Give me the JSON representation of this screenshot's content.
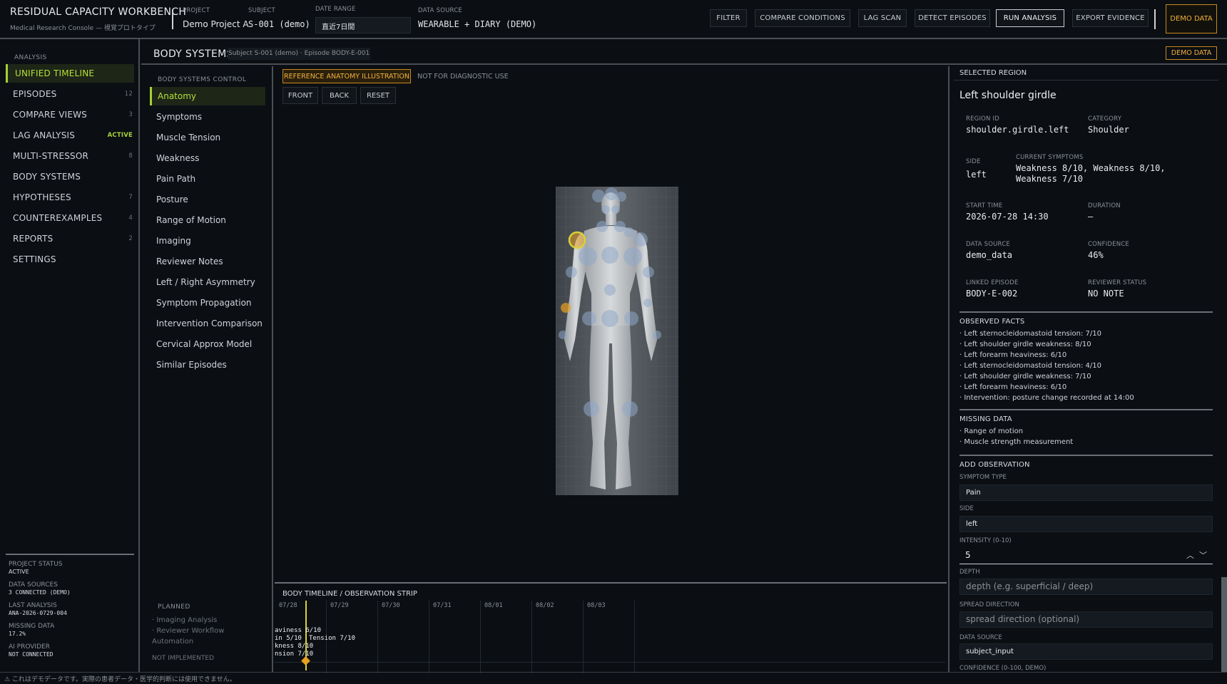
{
  "app": {
    "title": "RESIDUAL CAPACITY WORKBENCH",
    "subtitle": "Medical Research Console — 視覚プロトタイプ"
  },
  "meta": {
    "project_label": "PROJECT",
    "project": "Demo Project A",
    "subject_label": "SUBJECT",
    "subject": "S-001 (demo)",
    "daterange_label": "DATE RANGE",
    "daterange": "直近7日間",
    "source_label": "DATA SOURCE",
    "source": "WEARABLE + DIARY (DEMO)"
  },
  "toolbar": {
    "filter": "FILTER",
    "compare": "COMPARE CONDITIONS",
    "lag": "LAG SCAN",
    "detect": "DETECT EPISODES",
    "run": "RUN ANALYSIS",
    "export": "EXPORT EVIDENCE",
    "demo": "DEMO DATA"
  },
  "nav": {
    "section": "ANALYSIS",
    "items": [
      {
        "label": "UNIFIED TIMELINE",
        "badge": ""
      },
      {
        "label": "EPISODES",
        "badge": "12"
      },
      {
        "label": "COMPARE VIEWS",
        "badge": "3"
      },
      {
        "label": "LAG ANALYSIS",
        "badge": "ACTIVE"
      },
      {
        "label": "MULTI-STRESSOR",
        "badge": "8"
      },
      {
        "label": "BODY SYSTEMS",
        "badge": ""
      },
      {
        "label": "HYPOTHESES",
        "badge": "7"
      },
      {
        "label": "COUNTEREXAMPLES",
        "badge": "4"
      },
      {
        "label": "REPORTS",
        "badge": "2"
      },
      {
        "label": "SETTINGS",
        "badge": ""
      }
    ]
  },
  "status": {
    "project_status_label": "PROJECT STATUS",
    "project_status": "ACTIVE",
    "sources_label": "DATA SOURCES",
    "sources": "3 CONNECTED (DEMO)",
    "last_label": "LAST ANALYSIS",
    "last": "ANA-2026-0729-004",
    "missing_label": "MISSING DATA",
    "missing": "17.2%",
    "ai_label": "AI PROVIDER",
    "ai": "NOT CONNECTED"
  },
  "header": {
    "title": "BODY SYSTEMS",
    "sub": "Subject S-001 (demo) · Episode BODY-E-001",
    "demo": "DEMO DATA"
  },
  "control": {
    "section": "BODY SYSTEMS CONTROL",
    "items": [
      "Anatomy",
      "Symptoms",
      "Muscle Tension",
      "Weakness",
      "Pain Path",
      "Posture",
      "Range of Motion",
      "Imaging",
      "Reviewer Notes",
      "Left / Right Asymmetry",
      "Symptom Propagation",
      "Intervention Comparison",
      "Cervical Approx Model",
      "Similar Episodes"
    ],
    "planned_label": "PLANNED",
    "planned": [
      "Imaging Analysis",
      "Reviewer Workflow",
      "Automation"
    ],
    "not_impl": "NOT IMPLEMENTED"
  },
  "anatomy": {
    "ref": "REFERENCE ANATOMY ILLUSTRATION",
    "notdiag": "NOT FOR DIAGNOSTIC USE",
    "front": "FRONT",
    "back": "BACK",
    "reset": "RESET"
  },
  "timeline": {
    "title": "BODY TIMELINE / OBSERVATION STRIP",
    "dates": [
      "07/28",
      "07/29",
      "07/30",
      "07/31",
      "08/01",
      "08/02",
      "08/03"
    ],
    "events": [
      "aviness 6/10",
      "in 5/10",
      "Tension 7/10",
      "kness 8/10",
      "nsion 7/10"
    ]
  },
  "selected": {
    "heading": "SELECTED REGION",
    "title": "Left shoulder girdle",
    "region_id_label": "REGION ID",
    "region_id": "shoulder.girdle.left",
    "category_label": "CATEGORY",
    "category": "Shoulder",
    "side_label": "SIDE",
    "side": "left",
    "symptoms_label": "CURRENT SYMPTOMS",
    "symptoms": "Weakness 8/10, Weakness 8/10, Weakness 7/10",
    "start_label": "START TIME",
    "start": "2026-07-28 14:30",
    "duration_label": "DURATION",
    "duration": "—",
    "source_label": "DATA SOURCE",
    "source": "demo_data",
    "confidence_label": "CONFIDENCE",
    "confidence": "46%",
    "episode_label": "LINKED EPISODE",
    "episode": "BODY-E-002",
    "review_label": "REVIEWER STATUS",
    "review": "NO NOTE"
  },
  "facts": {
    "heading": "OBSERVED FACTS",
    "items": [
      "Left sternocleidomastoid tension: 7/10",
      "Left shoulder girdle weakness: 8/10",
      "Left forearm heaviness: 6/10",
      "Left sternocleidomastoid tension: 4/10",
      "Left shoulder girdle weakness: 7/10",
      "Left forearm heaviness: 6/10",
      "Intervention: posture change recorded at 14:00"
    ]
  },
  "missing": {
    "heading": "MISSING DATA",
    "items": [
      "Range of motion",
      "Muscle strength measurement"
    ]
  },
  "form": {
    "heading": "ADD OBSERVATION",
    "type_label": "SYMPTOM TYPE",
    "type": "Pain",
    "side_label": "SIDE",
    "side": "left",
    "intensity_label": "INTENSITY (0-10)",
    "intensity": "5",
    "depth_label": "DEPTH",
    "depth_ph": "depth (e.g. superficial / deep)",
    "spread_label": "SPREAD DIRECTION",
    "spread_ph": "spread direction (optional)",
    "source_label": "DATA SOURCE",
    "source": "subject_input",
    "conf_label": "CONFIDENCE (0-100, DEMO)"
  },
  "footer": "⚠ これはデモデータです。実際の患者データ・医学的判断には使用できません。",
  "colors": {
    "accent": "#a8d038",
    "warning": "#f0b23a",
    "marker": "#8fa7c8",
    "selected": "#d8d23a"
  }
}
